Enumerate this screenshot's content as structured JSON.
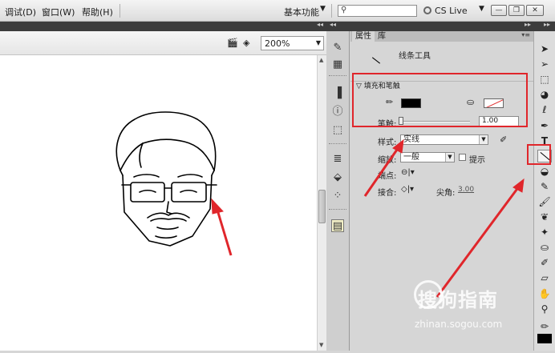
{
  "menubar": {
    "items": [
      "调试(D)",
      "窗口(W)",
      "帮助(H)"
    ],
    "workspace": "基本功能",
    "search_placeholder": "",
    "cs_live": "CS Live",
    "window_buttons": [
      "minimize",
      "restore",
      "close"
    ]
  },
  "stage": {
    "zoom": "200%"
  },
  "panel": {
    "tabs": [
      "属性",
      "库"
    ],
    "tool_name": "线条工具",
    "section_title": "填充和笔触",
    "stroke_color": "#000000",
    "fill_color": "none",
    "thickness_label": "笔触:",
    "thickness_value": "1.00",
    "style_label": "样式:",
    "style_value": "实线",
    "scale_label": "缩放:",
    "scale_value": "一般",
    "hint_label": "提示",
    "cap_label": "端点:",
    "join_label": "接合:",
    "miter_label": "尖角:",
    "miter_value": "3.00"
  },
  "watermark": {
    "brand": "搜狗指南",
    "url": "zhinan.sogou.com"
  },
  "colors": {
    "highlight": "#e0262b",
    "arrow": "#e0262b"
  }
}
